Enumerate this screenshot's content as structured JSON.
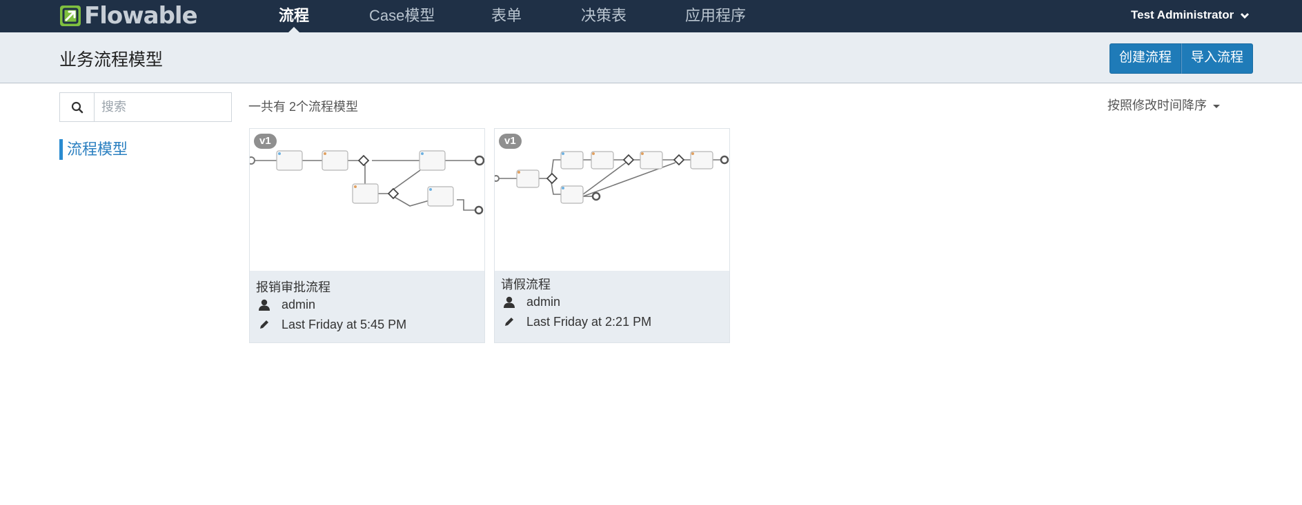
{
  "navbar": {
    "logo_text": "Flowable",
    "items": [
      {
        "label": "流程",
        "active": true
      },
      {
        "label": "Case模型",
        "active": false
      },
      {
        "label": "表单",
        "active": false
      },
      {
        "label": "决策表",
        "active": false
      },
      {
        "label": "应用程序",
        "active": false
      }
    ],
    "user_label": "Test Administrator"
  },
  "subheader": {
    "title": "业务流程模型",
    "create_button": "创建流程",
    "import_button": "导入流程"
  },
  "sidebar": {
    "search_placeholder": "搜索",
    "nav_item": "流程模型"
  },
  "main": {
    "total_count": "一共有 2个流程模型",
    "sort_label": "按照修改时间降序",
    "cards": [
      {
        "version": "v1",
        "title": "报销审批流程",
        "author": "admin",
        "modified": "Last Friday at 5:45 PM"
      },
      {
        "version": "v1",
        "title": "请假流程",
        "author": "admin",
        "modified": "Last Friday at 2:21 PM"
      }
    ]
  },
  "colors": {
    "navbar_bg": "#1f3046",
    "subheader_bg": "#e8edf2",
    "primary_button": "#1f7bb8",
    "logo_green": "#7fbf3f",
    "link_blue": "#2a7fc0"
  }
}
